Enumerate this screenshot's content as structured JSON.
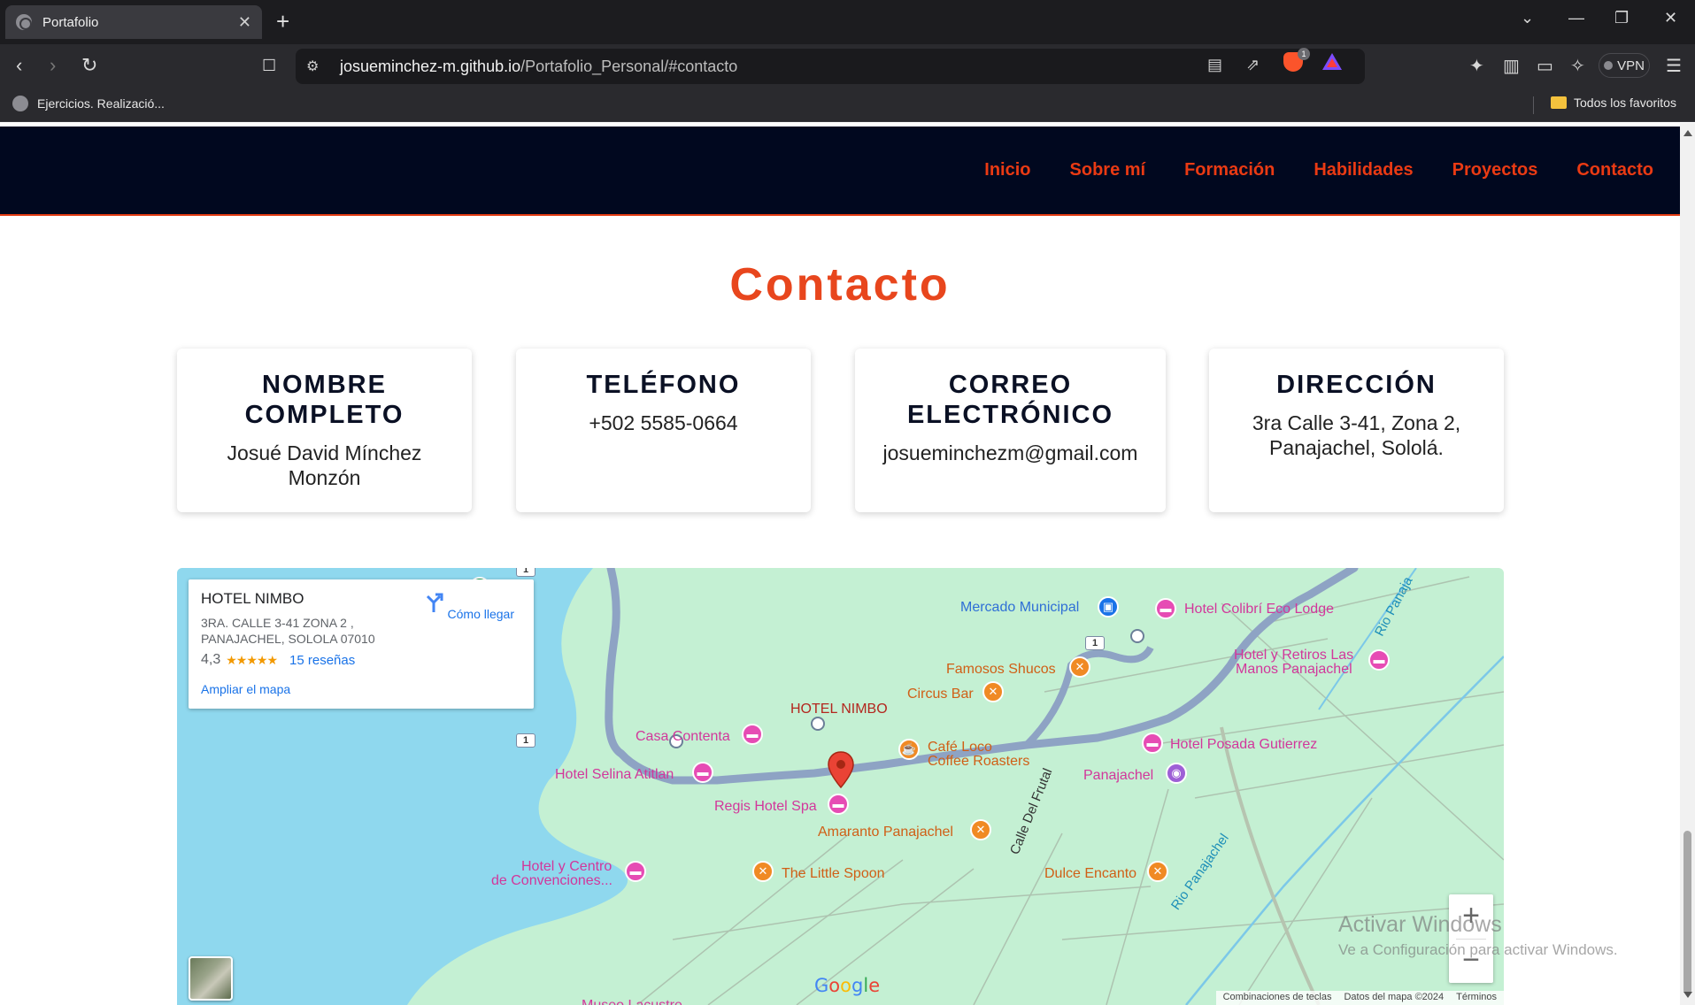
{
  "browser": {
    "tab_title": "Portafolio",
    "tab_close": "✕",
    "new_tab": "+",
    "url_host": "josueminchez-m.github.io",
    "url_path": "/Portafolio_Personal/#contacto",
    "vpn_label": "VPN",
    "brave_badge": "1",
    "bookmark_item": "Ejercicios. Realizació...",
    "all_bookmarks": "Todos los favoritos"
  },
  "nav": {
    "items": [
      "Inicio",
      "Sobre mí",
      "Formación",
      "Habilidades",
      "Proyectos",
      "Contacto"
    ]
  },
  "contact": {
    "title": "Contacto",
    "cards": [
      {
        "heading": "NOMBRE COMPLETO",
        "value": "Josué David Mínchez Monzón"
      },
      {
        "heading": "TELÉFONO",
        "value": "+502 5585-0664"
      },
      {
        "heading": "CORREO ELECTRÓNICO",
        "value": "josueminchezm@gmail.com"
      },
      {
        "heading": "DIRECCIÓN",
        "value": "3ra Calle 3-41, Zona 2, Panajachel, Sololá."
      }
    ]
  },
  "map": {
    "place_name": "HOTEL NIMBO",
    "address_line1": "3RA. CALLE 3-41 ZONA 2 ,",
    "address_line2": "PANAJACHEL, SOLOLA 07010",
    "rating": "4,3",
    "stars": "★★★★★",
    "reviews": "15 reseñas",
    "expand": "Ampliar el mapa",
    "directions": "Cómo llegar",
    "marker_label": "HOTEL NIMBO",
    "zoom_in": "+",
    "zoom_out": "−",
    "pois": {
      "mercado": "Mercado Municipal",
      "colibri": "Hotel Colibrí Eco Lodge",
      "retiros_1": "Hotel y Retiros Las",
      "retiros_2": "Manos Panajachel",
      "shucos": "Famosos Shucos",
      "circus": "Circus Bar",
      "contenta": "Casa Contenta",
      "cafeloco_1": "Café Loco",
      "cafeloco_2": "Coffee Roasters",
      "posada": "Hotel Posada Gutierrez",
      "selina": "Hotel Selina Atitlan",
      "panajachel": "Panajachel",
      "regis": "Regis Hotel Spa",
      "amaranto": "Amaranto Panajachel",
      "centro_1": "Hotel y Centro",
      "centro_2": "de Convenciones...",
      "spoon": "The Little Spoon",
      "dulce": "Dulce Encanto",
      "museo": "Museo Lacustre"
    },
    "streets": {
      "frutal": "Calle Del Frutal",
      "rio_1": "Rio Panajachel",
      "rio_2": "Rio Panaja"
    },
    "route_shield": "1",
    "google": "Google",
    "attrib": [
      "Combinaciones de teclas",
      "Datos del mapa ©2024",
      "Términos"
    ]
  },
  "watermark": {
    "line1": "Activar Windows",
    "line2": "Ve a Configuración para activar Windows."
  },
  "colors": {
    "nav_bg": "#01081f",
    "accent": "#ea3a13",
    "map_land": "#c4f0d3",
    "map_water": "#8fd8ee",
    "map_road": "#8ea3c4"
  }
}
